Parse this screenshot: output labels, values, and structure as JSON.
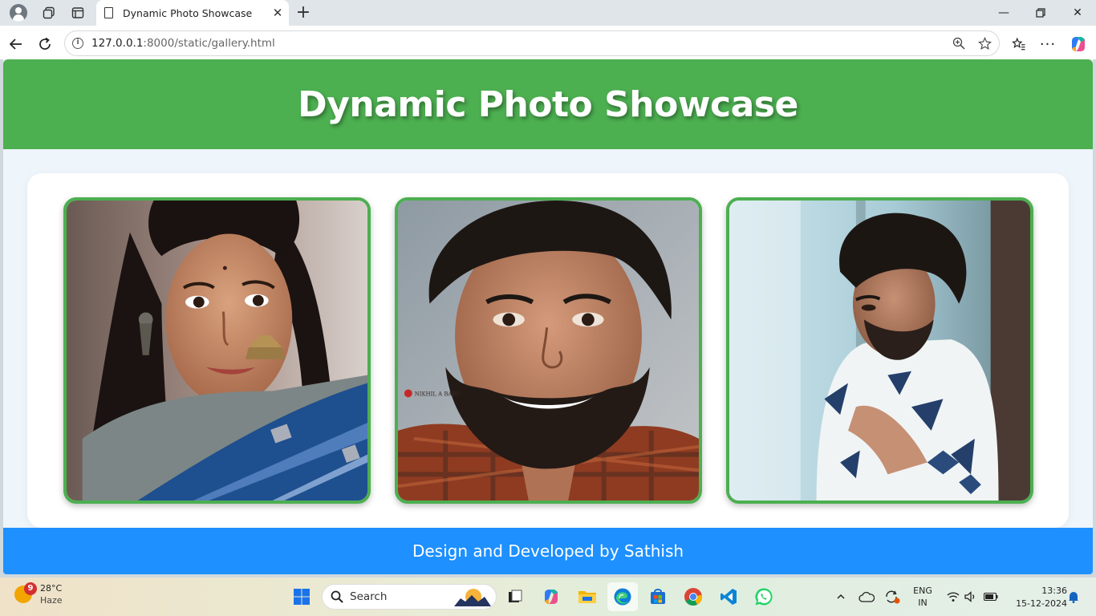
{
  "browser": {
    "tab_title": "Dynamic Photo Showcase",
    "url_host": "127.0.0.1",
    "url_rest": ":8000/static/gallery.html"
  },
  "page": {
    "heading": "Dynamic Photo Showcase",
    "footer_text": "Design and Developed by Sathish",
    "photos": [
      {
        "subject": "woman with earrings in blue saree"
      },
      {
        "subject": "smiling bearded man in plaid shirt",
        "watermark": "NIKHIL A BABU"
      },
      {
        "subject": "curly-haired man in patterned sweater by window"
      }
    ],
    "colors": {
      "header": "#4caf50",
      "footer": "#1e90ff",
      "frame": "#4caf50"
    }
  },
  "taskbar": {
    "weather_temp": "28°C",
    "weather_desc": "Haze",
    "weather_badge": "9",
    "search_label": "Search",
    "lang_top": "ENG",
    "lang_bottom": "IN",
    "time": "13:36",
    "date": "15-12-2024"
  }
}
